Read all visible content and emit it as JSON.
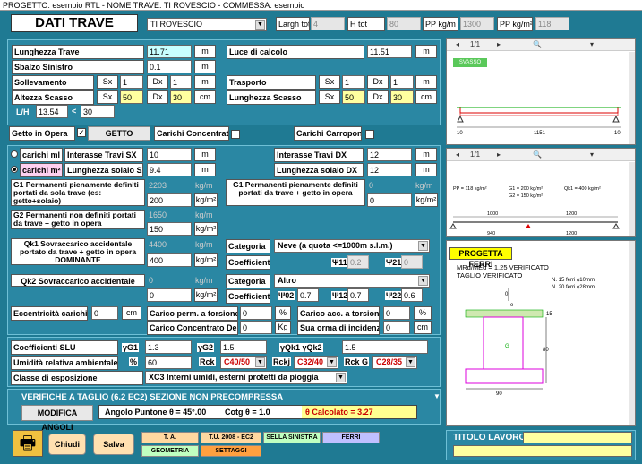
{
  "title_bar": "PROGETTO: esempio RTL - NOME TRAVE: TI ROVESCIO - COMMESSA: esempio",
  "header": {
    "dati_trave": "DATI TRAVE",
    "trave_name": "TI ROVESCIO",
    "largh_tot_label": "Largh tot",
    "largh_tot": "4",
    "h_tot_label": "H tot",
    "h_tot": "80",
    "pp_kgm_label": "PP kg/m",
    "pp_kgm": "1300",
    "pp_kgm2_label": "PP kg/m²",
    "pp_kgm2": "118"
  },
  "geom": {
    "lunghezza_label": "Lunghezza Trave",
    "lunghezza": "11.71",
    "unit_m": "m",
    "luce_label": "Luce di calcolo",
    "luce": "11.51",
    "sbalzo_label": "Sbalzo Sinistro",
    "sbalzo": "0.1",
    "sollev_label": "Sollevamento",
    "sx": "Sx",
    "dx": "Dx",
    "sollev_sx": "1",
    "sollev_dx": "1",
    "trasporto_label": "Trasporto",
    "trasp_sx": "1",
    "trasp_dx": "1",
    "scasso_label": "Altezza Scasso",
    "scasso_sx": "50",
    "scasso_dx": "30",
    "unit_cm": "cm",
    "lscasso_label": "Lunghezza Scasso",
    "lscasso_sx": "50",
    "lscasso_dx": "30",
    "lh_label": "L/H",
    "lh": "13.54",
    "lt": "<",
    "lh_lim": "30"
  },
  "getto": {
    "getto_label": "Getto in Opera",
    "getto_btn": "GETTO",
    "conc_label": "Carichi Concentrati",
    "carroponte_label": "Carichi Carroponte"
  },
  "loads": {
    "radio1": "carichi ml",
    "radio2": "carichi m²",
    "int_sx_label": "Interasse Travi SX",
    "int_sx": "10",
    "int_dx_label": "Interasse Travi DX",
    "int_dx": "12",
    "solaio_sx_label": "Lunghezza solaio SX",
    "solaio_sx": "9.4",
    "solaio_dx_label": "Lunghezza solaio DX",
    "solaio_dx": "12",
    "g1_label": "G1 Permanenti pienamente definiti portati da sola trave (es: getto+solaio)",
    "g1_grey": "2203",
    "g1": "200",
    "unit_kgm": "kg/m",
    "unit_kgm2": "kg/m²",
    "g1b_label": "G1 Permanenti pienamente definiti portati da trave + getto in opera",
    "g1b_grey": "0",
    "g1b": "0",
    "g2_label": "G2 Permanenti non definiti portati da trave + getto in opera",
    "g2_grey": "1650",
    "g2": "150",
    "qk1_label": "Qk1  Sovraccarico accidentale portato da trave + getto in opera DOMINANTE",
    "qk1_grey": "4400",
    "qk1": "400",
    "categoria": "Categoria",
    "coefficienti": "Coefficienti",
    "cat1": "Neve (a quota <=1000m s.l.m.)",
    "psi1_label": "Ψ11",
    "psi1": "0.2",
    "psi21_label": "Ψ21",
    "psi21": "0",
    "qk2_label": "Qk2  Sovraccarico accidentale",
    "qk2_grey": "0",
    "qk2": "0",
    "cat2": "Altro",
    "psi02_label": "Ψ02",
    "psi02": "0.7",
    "psi12_label": "Ψ12",
    "psi12": "0.7",
    "psi22_label": "Ψ22",
    "psi22": "0.6",
    "ecc_label": "Eccentricità carichi",
    "ecc": "0",
    "torsione_label": "Carico perm. a torsione",
    "torsione": "0",
    "unit_pct": "%",
    "acc_tors_label": "Carico acc. a torsione",
    "acc_tors": "0",
    "conc_dente_label": "Carico Concentrato Dente",
    "conc_dente": "0",
    "unit_kg": "Kg",
    "orma_label": "Sua orma di incidenza",
    "orma": "0"
  },
  "coeff": {
    "slu_label": "Coefficienti SLU",
    "g1_lbl": "γG1",
    "g1": "1.3",
    "g2_lbl": "γG2",
    "g2": "1.5",
    "q_lbl": "γQk1  γQk2",
    "q": "1.5",
    "umid_label": "Umidità relativa ambientale",
    "umid_unit": "%",
    "umid": "60",
    "rck_label": "Rck",
    "rck": "C40/50",
    "rckj_label": "Rckj",
    "rckj": "C32/40",
    "rckg_label": "Rck G",
    "rckg": "C28/35",
    "esp_label": "Classe di esposizione",
    "esp": "XC3   Interni umidi, esterni protetti da pioggia"
  },
  "verifiche": {
    "title": "VERIFICHE A TAGLIO (6.2 EC2) SEZIONE NON PRECOMPRESSA",
    "btn": "MODIFICA ANGOLI",
    "angolo": "Angolo Puntone  θ =  45°.00",
    "cotg": "Cotg θ = 1.0",
    "calcolato": "θ  Calcolato =  3.27"
  },
  "bottom": {
    "chiudi": "Chiudi",
    "salva": "Salva",
    "ta": "T. A.",
    "tu": "T.U. 2008 - EC2",
    "sella": "SELLA SINISTRA",
    "ferri": "FERRI",
    "geometria": "GEOMETRIA",
    "settaggi": "SETTAGGI",
    "titolo": "TITOLO LAVORO"
  },
  "viewer1": {
    "page": "1/1",
    "badge": "SVASSO",
    "dim_left": "10",
    "dim_mid": "1151",
    "dim_right": "10"
  },
  "viewer2": {
    "page": "1/1",
    "pp": "PP = 118 kg/m²",
    "g1": "G1 = 200 kg/m²",
    "g2": "G2 = 150 kg/m²",
    "qk1": "Qk1 = 400 kg/m²",
    "d1": "1000",
    "d2": "1200",
    "d3": "940",
    "d4": "1200"
  },
  "section": {
    "btn": "PROGETTA FERRI",
    "verif1": "MRd/MEd = 1.25 VERIFICATO",
    "verif2": "TAGLIO VERIFICATO",
    "ferri1": "N. 15 ferri ɸ10mm",
    "ferri2": "N. 20 ferri ɸ28mm",
    "top": "0",
    "e": "e",
    "w15": "15",
    "h80": "80",
    "w90": "90",
    "g": "G"
  }
}
